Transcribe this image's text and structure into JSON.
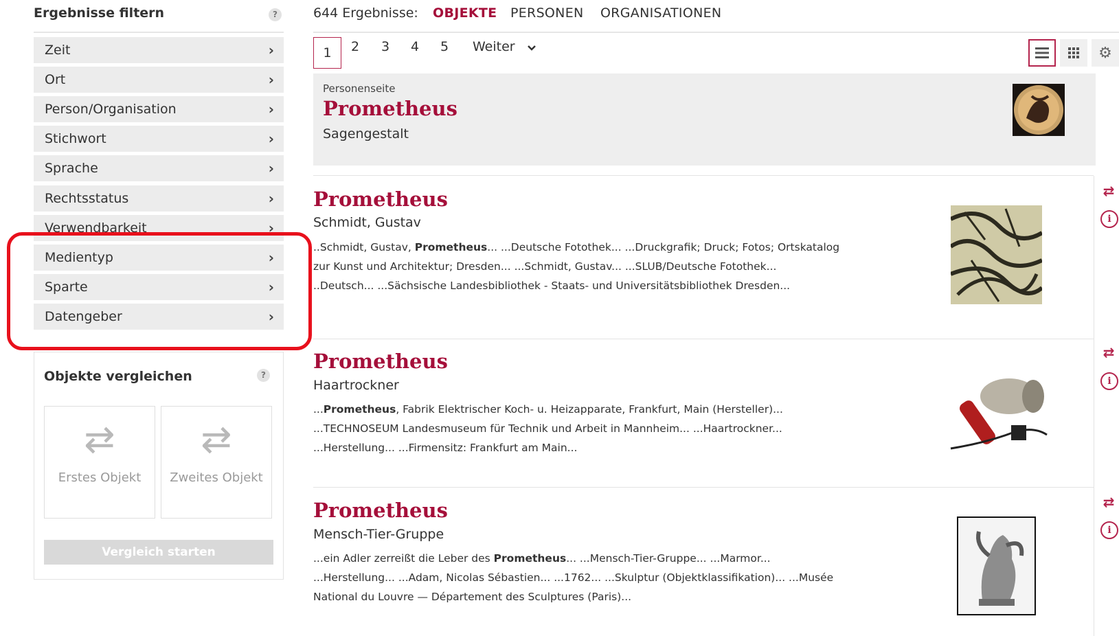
{
  "sidebar": {
    "title": "Ergebnisse filtern",
    "help": "?",
    "facets": [
      {
        "label": "Zeit"
      },
      {
        "label": "Ort"
      },
      {
        "label": "Person/Organisation"
      },
      {
        "label": "Stichwort"
      },
      {
        "label": "Sprache"
      },
      {
        "label": "Rechtsstatus"
      },
      {
        "label": "Verwendbarkeit"
      },
      {
        "label": "Medientyp"
      },
      {
        "label": "Sparte"
      },
      {
        "label": "Datengeber"
      }
    ],
    "chevron": "›",
    "compare": {
      "title": "Objekte vergleichen",
      "help": "?",
      "first_slot": "Erstes Objekt",
      "second_slot": "Zweites Objekt",
      "start_button": "Vergleich starten"
    }
  },
  "results_bar": {
    "count_label": "644 Ergebnisse:",
    "tabs": [
      "OBJEKTE",
      "PERSONEN",
      "ORGANISATIONEN"
    ]
  },
  "pager": {
    "pages": [
      "1",
      "2",
      "3",
      "4",
      "5"
    ],
    "next_label": "Weiter",
    "next_icon": "chevron-down-icon"
  },
  "person_card": {
    "kicker": "Personenseite",
    "title": "Prometheus",
    "subtitle": "Sagengestalt"
  },
  "results": [
    {
      "title": "Prometheus",
      "subtitle": "Schmidt, Gustav",
      "lines": [
        [
          {
            "t": "..Schmidt, Gustav, "
          },
          {
            "t": "Prometheus",
            "b": true
          },
          {
            "t": "... ...Deutsche Fotothek... ...Druckgrafik; Druck; Fotos; Ortskatalog"
          }
        ],
        [
          {
            "t": "zur Kunst und Architektur; Dresden... ...Schmidt, Gustav... ...SLUB/Deutsche Fotothek..."
          }
        ],
        [
          {
            "t": "..Deutsch... ...Sächsische Landesbibliothek - Staats- und Universitätsbibliothek Dresden..."
          }
        ]
      ]
    },
    {
      "title": "Prometheus",
      "subtitle": "Haartrockner",
      "lines": [
        [
          {
            "t": "..."
          },
          {
            "t": "Prometheus",
            "b": true
          },
          {
            "t": ", Fabrik Elektrischer Koch- u. Heizapparate, Frankfurt, Main (Hersteller)..."
          }
        ],
        [
          {
            "t": "...TECHNOSEUM Landesmuseum für Technik und Arbeit in Mannheim... ...Haartrockner..."
          }
        ],
        [
          {
            "t": "...Herstellung... ...Firmensitz: Frankfurt am Main..."
          }
        ]
      ]
    },
    {
      "title": "Prometheus",
      "subtitle": "Mensch-Tier-Gruppe",
      "lines": [
        [
          {
            "t": "...ein Adler zerreißt die Leber des "
          },
          {
            "t": "Prometheus",
            "b": true
          },
          {
            "t": "... ...Mensch-Tier-Gruppe... ...Marmor..."
          }
        ],
        [
          {
            "t": "...Herstellung... ...Adam, Nicolas Sébastien... ...1762... ...Skulptur (Objektklassifikation)... ...Musée"
          }
        ],
        [
          {
            "t": "National du Louvre — Département des Sculptures (Paris)..."
          }
        ]
      ]
    }
  ],
  "colors": {
    "accent": "#a50f3a",
    "highlight": "#e8101c"
  }
}
